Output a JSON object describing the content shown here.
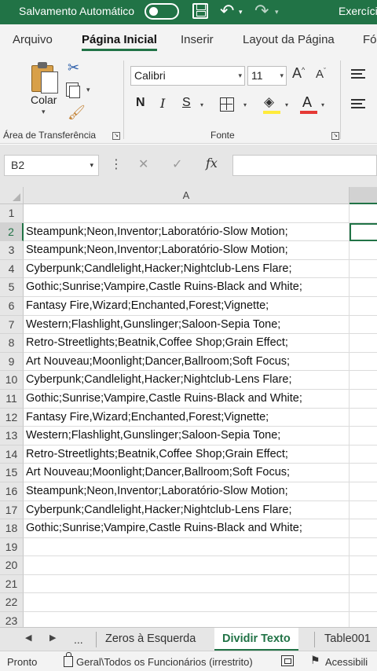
{
  "titlebar": {
    "autosave_label": "Salvamento Automático",
    "autosave_state": "off",
    "filename": "Exercício"
  },
  "ribbon_tabs": [
    "Arquivo",
    "Página Inicial",
    "Inserir",
    "Layout da Página",
    "Fó"
  ],
  "active_tab": "Página Inicial",
  "clipboard": {
    "paste_label": "Colar",
    "group_label": "Área de Transferência"
  },
  "font": {
    "name": "Calibri",
    "size": "11",
    "grow_label": "A",
    "shrink_label": "A",
    "bold_label": "N",
    "italic_label": "I",
    "underline_label": "S",
    "font_color_label": "A",
    "group_label": "Fonte"
  },
  "formula_bar": {
    "name_box": "B2",
    "fx_label": "fx",
    "value": ""
  },
  "grid": {
    "column_header": "A",
    "active_row": 2,
    "rows": [
      {
        "n": "1",
        "a": ""
      },
      {
        "n": "2",
        "a": "Steampunk;Neon,Inventor;Laboratório-Slow Motion;"
      },
      {
        "n": "3",
        "a": "Steampunk;Neon,Inventor;Laboratório-Slow Motion;"
      },
      {
        "n": "4",
        "a": "Cyberpunk;Candlelight,Hacker;Nightclub-Lens Flare;"
      },
      {
        "n": "5",
        "a": "Gothic;Sunrise;Vampire,Castle Ruins-Black and White;"
      },
      {
        "n": "6",
        "a": "Fantasy Fire,Wizard;Enchanted,Forest;Vignette;"
      },
      {
        "n": "7",
        "a": "Western;Flashlight,Gunslinger;Saloon-Sepia Tone;"
      },
      {
        "n": "8",
        "a": "Retro-Streetlights;Beatnik,Coffee Shop;Grain Effect;"
      },
      {
        "n": "9",
        "a": "Art Nouveau;Moonlight;Dancer,Ballroom;Soft Focus;"
      },
      {
        "n": "10",
        "a": "Cyberpunk;Candlelight,Hacker;Nightclub-Lens Flare;"
      },
      {
        "n": "11",
        "a": "Gothic;Sunrise;Vampire,Castle Ruins-Black and White;"
      },
      {
        "n": "12",
        "a": "Fantasy Fire,Wizard;Enchanted,Forest;Vignette;"
      },
      {
        "n": "13",
        "a": "Western;Flashlight,Gunslinger;Saloon-Sepia Tone;"
      },
      {
        "n": "14",
        "a": "Retro-Streetlights;Beatnik,Coffee Shop;Grain Effect;"
      },
      {
        "n": "15",
        "a": "Art Nouveau;Moonlight;Dancer,Ballroom;Soft Focus;"
      },
      {
        "n": "16",
        "a": "Steampunk;Neon,Inventor;Laboratório-Slow Motion;"
      },
      {
        "n": "17",
        "a": "Cyberpunk;Candlelight,Hacker;Nightclub-Lens Flare;"
      },
      {
        "n": "18",
        "a": "Gothic;Sunrise;Vampire,Castle Ruins-Black and White;"
      },
      {
        "n": "19",
        "a": ""
      },
      {
        "n": "20",
        "a": ""
      },
      {
        "n": "21",
        "a": ""
      },
      {
        "n": "22",
        "a": ""
      },
      {
        "n": "23",
        "a": ""
      }
    ]
  },
  "sheet_tabs": {
    "more_label": "...",
    "tabs": [
      "Zeros à Esquerda",
      "Dividir Texto",
      "Table001"
    ],
    "active": "Dividir Texto"
  },
  "statusbar": {
    "ready": "Pronto",
    "sensitivity": "Geral\\Todos os Funcionários (irrestrito)",
    "accessibility": "Acessibili"
  },
  "colors": {
    "brand": "#217346",
    "fill_color": "#ffeb3b",
    "font_color": "#e53935"
  }
}
